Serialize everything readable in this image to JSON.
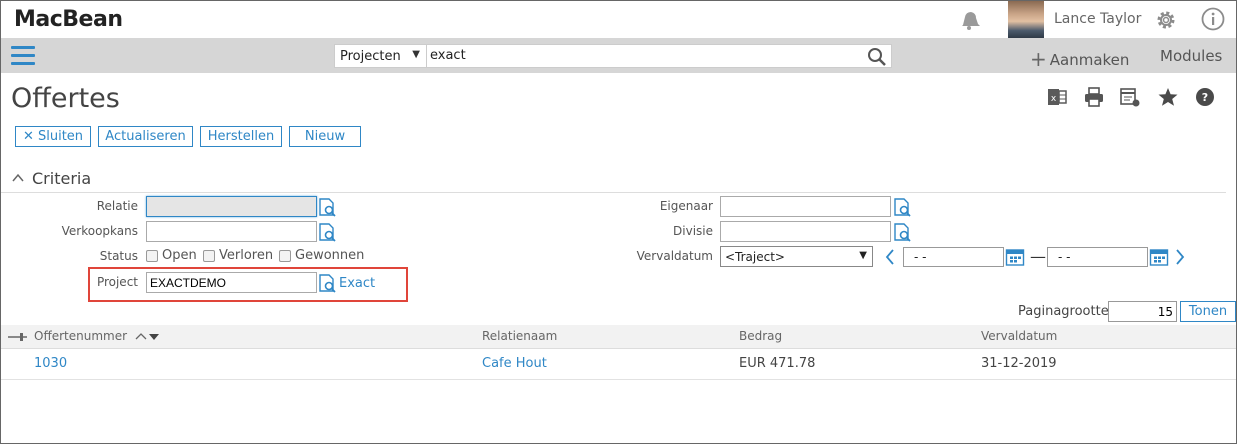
{
  "app": {
    "logo": "MacBean"
  },
  "header": {
    "user_name": "Lance Taylor",
    "icons": [
      "bell-icon",
      "gear-icon",
      "info-icon"
    ]
  },
  "navbar": {
    "search_scope": "Projecten",
    "search_value": "exact",
    "create_label": "Aanmaken",
    "modules_label": "Modules"
  },
  "page": {
    "title": "Offertes",
    "toolbar_icons": [
      "excel-icon",
      "print-icon",
      "export-icon",
      "star-icon",
      "help-icon"
    ]
  },
  "actions": {
    "close": "Sluiten",
    "refresh": "Actualiseren",
    "reset": "Herstellen",
    "new": "Nieuw"
  },
  "criteria": {
    "title": "Criteria",
    "relatie_label": "Relatie",
    "verkoopkans_label": "Verkoopkans",
    "status_label": "Status",
    "status_options": [
      "Open",
      "Verloren",
      "Gewonnen"
    ],
    "project_label": "Project",
    "project_value": "EXACTDEMO",
    "project_link": "Exact",
    "eigenaar_label": "Eigenaar",
    "divisie_label": "Divisie",
    "vervaldatum_label": "Vervaldatum",
    "vervaldatum_select": "<Traject>",
    "date_from": "-  -",
    "date_to": "-  -",
    "range_separator": "—"
  },
  "paging": {
    "label": "Paginagrootte",
    "value": "15",
    "button": "Tonen"
  },
  "table": {
    "columns": [
      "Offertenummer",
      "Relatienaam",
      "Bedrag",
      "Vervaldatum"
    ],
    "rows": [
      {
        "nummer": "1030",
        "relatie": "Cafe Hout",
        "bedrag": "EUR 471.78",
        "vervaldatum": "31-12-2019"
      }
    ]
  },
  "colors": {
    "accent": "#2f87c6",
    "highlight": "#e0453a",
    "navbar": "#d6d6d6"
  }
}
